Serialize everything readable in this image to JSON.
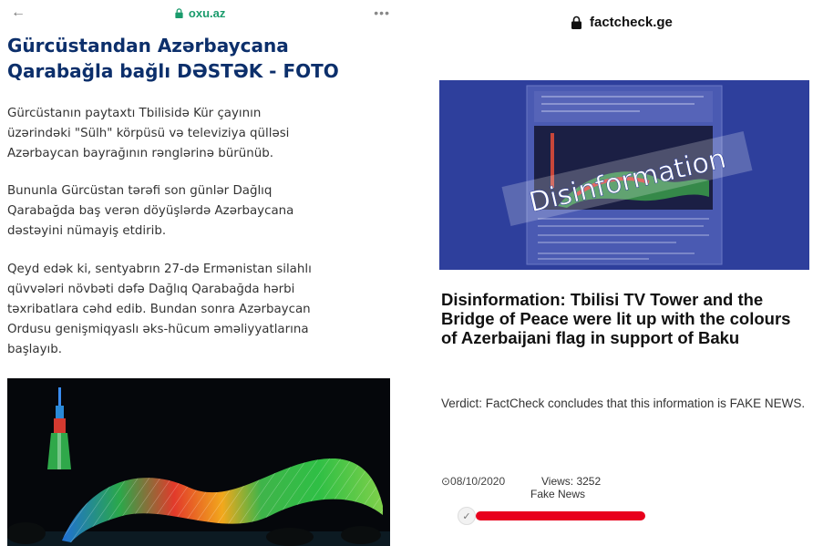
{
  "left": {
    "url": "oxu.az",
    "headline_line1": "Gürcüstandan Azərbaycana",
    "headline_line2": "Qarabağla bağlı DƏSTƏK - FOTO",
    "paragraphs": [
      [
        "Gürcüstanın paytaxtı Tbilisidə Kür çayının",
        "üzərindəki \"Sülh\" körpüsü və televiziya qülləsi",
        "Azərbaycan bayrağının rənglərinə bürünüb."
      ],
      [
        "Bununla Gürcüstan tərəfi son günlər Dağlıq",
        "Qarabağda baş verən döyüşlərdə Azərbaycana",
        "dəstəyini nümayiş etdirib."
      ],
      [
        "Qeyd edək ki, sentyabrın 27-də Ermənistan silahlı",
        "qüvvələri növbəti dəfə Dağlıq Qarabağda hərbi",
        "təxribatlara cəhd edib. Bundan sonra Azərbaycan",
        "Ordusu genişmiqyaslı əks-hücum əməliyyatlarına",
        "başlayıb."
      ]
    ],
    "icons": {
      "back": "back-arrow-icon",
      "lock": "lock-icon",
      "menu": "more-dots-icon"
    },
    "colors": {
      "url": "#1a9b6c",
      "headline": "#0c2f6b"
    }
  },
  "right": {
    "url": "factcheck.ge",
    "stamp": "Disinformation",
    "title": "Disinformation: Tbilisi TV Tower and the Bridge of Peace were lit up with the colours of Azerbaijani flag in support of Baku",
    "verdict": "Verdict: FactCheck concludes that this information is FAKE NEWS.",
    "date": "⊙08/10/2020",
    "views": "Views: 3252",
    "tag": "Fake News",
    "colors": {
      "bar": "#e8001c",
      "image_bg": "#2e3f9c"
    }
  }
}
